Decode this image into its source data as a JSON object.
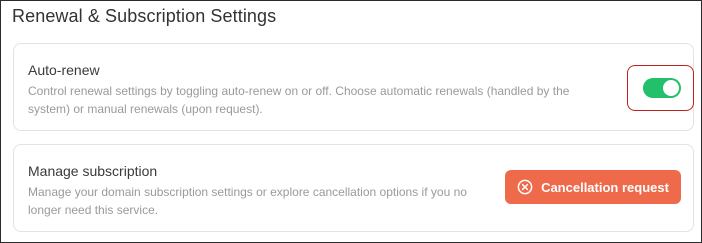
{
  "section": {
    "title": "Renewal & Subscription Settings"
  },
  "auto_renew": {
    "title": "Auto-renew",
    "description": "Control renewal settings by toggling auto-renew on or off. Choose automatic renewals (handled by the system) or manual renewals (upon request).",
    "enabled": true,
    "toggle_color": "#22c06a",
    "highlight_color": "#c21f1f"
  },
  "manage_subscription": {
    "title": "Manage subscription",
    "description": "Manage your domain subscription settings or explore cancellation options if you no longer need this service.",
    "button_label": "Cancellation request",
    "button_icon": "x-circle-icon",
    "button_color": "#ee6a4a"
  }
}
